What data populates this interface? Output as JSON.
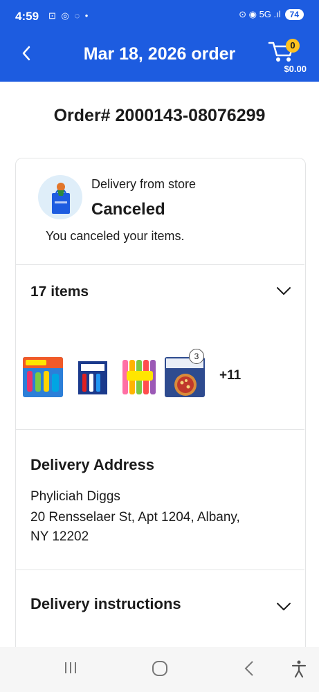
{
  "status_bar": {
    "time": "4:59",
    "left_icons": "⊡ ◎ ◌ •",
    "right_icons": "⊙ ◉ 5G .ıl",
    "battery": "74"
  },
  "header": {
    "back_icon": "chevron-left-icon",
    "title": "Mar 18, 2026 order",
    "cart_count": "0",
    "cart_total": "$0.00"
  },
  "order_number": "Order# 2000143-08076299",
  "status": {
    "delivery_type": "Delivery from store",
    "title": "Canceled",
    "message": "You canceled your items."
  },
  "items": {
    "count_label": "17 items",
    "thumbnails": [
      "Popsicle Jolly Rancher pops",
      "Ice pops variety pack",
      "Twin Pops",
      "Deep Dish pizza"
    ],
    "last_thumb_qty": "3",
    "more_label": "+11"
  },
  "delivery_address": {
    "heading": "Delivery Address",
    "name": "Phyliciah Diggs",
    "line1": "20 Rensselaer St, Apt 1204, Albany,",
    "line2": "NY 12202"
  },
  "delivery_instructions": {
    "heading": "Delivery instructions"
  },
  "colors": {
    "brand_blue": "#1d5ce0",
    "badge_yellow": "#ffc220"
  }
}
